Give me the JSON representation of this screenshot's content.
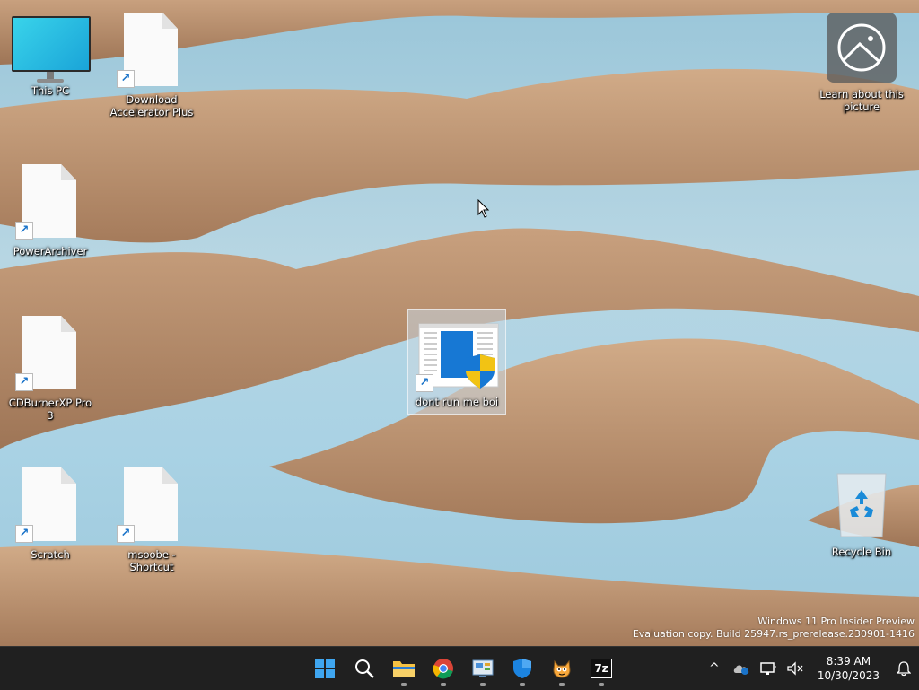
{
  "desktop_icons": [
    {
      "id": "this-pc",
      "label": "This PC"
    },
    {
      "id": "download-accelerator",
      "label": "Download Accelerator Plus"
    },
    {
      "id": "power-archiver",
      "label": "PowerArchiver"
    },
    {
      "id": "cdburnerxp",
      "label": "CDBurnerXP Pro 3"
    },
    {
      "id": "scratch",
      "label": "Scratch"
    },
    {
      "id": "msoobe",
      "label": "msoobe - Shortcut"
    },
    {
      "id": "dont-run",
      "label": "dont run me boi"
    },
    {
      "id": "recycle-bin",
      "label": "Recycle Bin"
    },
    {
      "id": "learn-picture",
      "label": "Learn about this picture"
    }
  ],
  "watermark": {
    "line1": "Windows 11 Pro Insider Preview",
    "line2": "Evaluation copy. Build 25947.rs_prerelease.230901-1416"
  },
  "taskbar": {
    "apps": [
      {
        "name": "start-button",
        "icon": "windows-logo-icon"
      },
      {
        "name": "search-button",
        "icon": "search-icon"
      },
      {
        "name": "file-explorer",
        "icon": "folder-icon",
        "running": true
      },
      {
        "name": "chrome",
        "icon": "chrome-icon",
        "running": true
      },
      {
        "name": "control-panel",
        "icon": "control-panel-icon",
        "running": true
      },
      {
        "name": "windows-security",
        "icon": "shield-icon",
        "running": true
      },
      {
        "name": "scratch-app",
        "icon": "scratch-cat-icon",
        "running": true
      },
      {
        "name": "7zip",
        "icon": "7zip-icon",
        "running": true,
        "label": "7z"
      }
    ],
    "tray": {
      "chevron": "^",
      "time": "8:39 AM",
      "date": "10/30/2023"
    }
  },
  "colors": {
    "taskbar": "#202020",
    "accent": "#0078d4"
  }
}
